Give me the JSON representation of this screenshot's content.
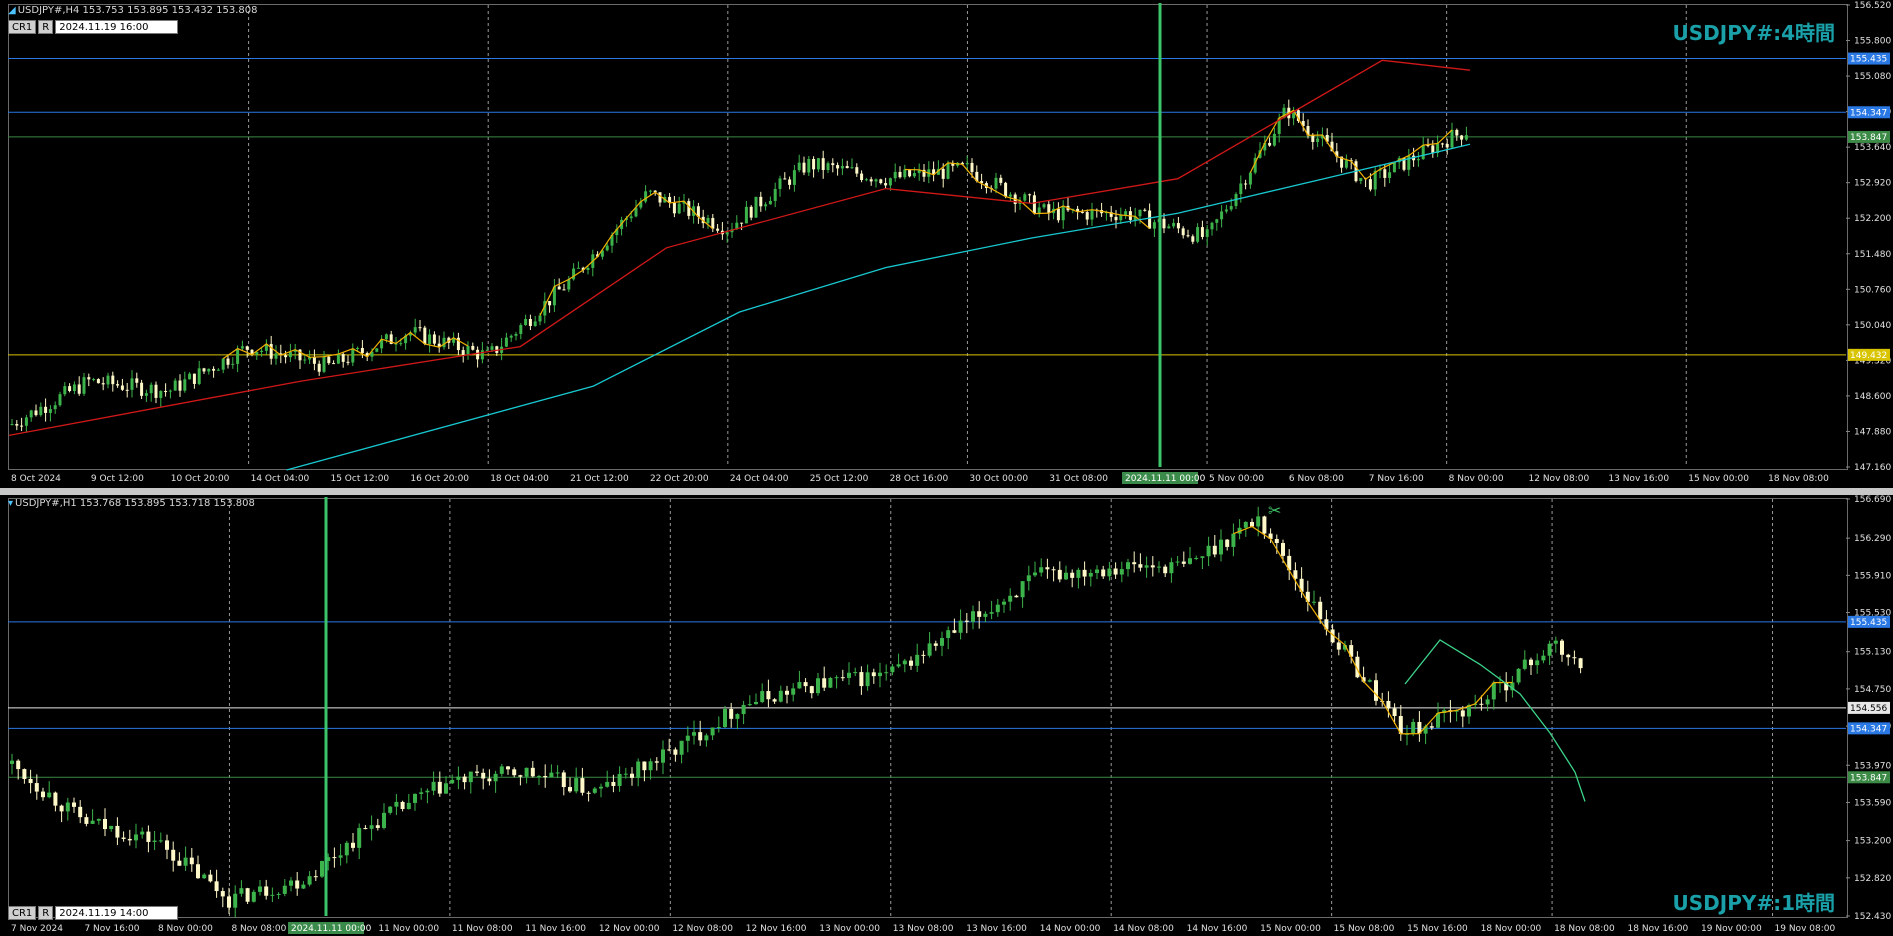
{
  "top": {
    "header": "USDJPY#,H4  153.753 153.895 153.432 153.808",
    "badge": {
      "a": "CR1",
      "b": "R",
      "datetime": "2024.11.19 16:00"
    },
    "title": "USDJPY#:4時間",
    "cursor_label": "2024.11.11 00:00",
    "lines": {
      "blue1": "155.435",
      "blue2": "154.347",
      "green": "153.847",
      "yellow": "149.432"
    }
  },
  "bottom": {
    "header": "USDJPY#,H1  153.768 153.895 153.718 153.808",
    "badge": {
      "a": "CR1",
      "b": "R",
      "datetime": "2024.11.19 14:00"
    },
    "title": "USDJPY#:1時間",
    "cursor_label": "2024.11.11 00:00",
    "lines": {
      "blue1": "155.435",
      "white": "154.556",
      "blue2": "154.347",
      "green": "153.847"
    }
  },
  "colors": {
    "bull": "#3cb44b",
    "bear": "#fff8c8",
    "grid": "#9a9a9a",
    "ma_red": "#d01818",
    "ma_cyan": "#18c8d0",
    "zigzag": "#f0b000",
    "hline_blue": "#2a78e4",
    "hline_yellow": "#d8c400",
    "hline_green": "#3b8a46",
    "cursor": "#3cc46a",
    "title": "#1aa0a8"
  },
  "chart_data": [
    {
      "type": "candlestick",
      "title": "USDJPY#:4時間",
      "symbol": "USDJPY#",
      "timeframe": "H4",
      "ylim": [
        147.16,
        156.52
      ],
      "y_ticks": [
        "156.520",
        "155.800",
        "155.080",
        "154.360",
        "153.640",
        "152.920",
        "152.200",
        "151.480",
        "150.760",
        "150.040",
        "149.320",
        "148.600",
        "147.880",
        "147.160"
      ],
      "x_ticks": [
        "8 Oct 2024",
        "9 Oct 12:00",
        "10 Oct 20:00",
        "14 Oct 04:00",
        "15 Oct 12:00",
        "16 Oct 20:00",
        "18 Oct 04:00",
        "21 Oct 12:00",
        "22 Oct 20:00",
        "24 Oct 04:00",
        "25 Oct 12:00",
        "28 Oct 16:00",
        "30 Oct 00:00",
        "31 Oct 08:00",
        "1 Nov 16:00",
        "5 Nov 00:00",
        "6 Nov 08:00",
        "7 Nov 16:00",
        "8 Nov 00:00",
        "12 Nov 08:00",
        "13 Nov 16:00",
        "15 Nov 00:00",
        "18 Nov 08:00"
      ],
      "path_points": [
        [
          "8 Oct 2024",
          148.0
        ],
        [
          "9 Oct 12:00",
          148.9
        ],
        [
          "10 Oct 20:00",
          148.7
        ],
        [
          "14 Oct 04:00",
          149.6
        ],
        [
          "15 Oct 12:00",
          149.2
        ],
        [
          "16 Oct 20:00",
          149.9
        ],
        [
          "18 Oct 04:00",
          149.4
        ],
        [
          "21 Oct 12:00",
          150.9
        ],
        [
          "22 Oct 20:00",
          152.7
        ],
        [
          "24 Oct 04:00",
          152.0
        ],
        [
          "25 Oct 12:00",
          153.3
        ],
        [
          "28 Oct 16:00",
          153.0
        ],
        [
          "30 Oct 00:00",
          153.2
        ],
        [
          "31 Oct 08:00",
          152.3
        ],
        [
          "1 Nov 16:00",
          152.3
        ],
        [
          "5 Nov 00:00",
          151.8
        ],
        [
          "6 Nov 08:00",
          154.4
        ],
        [
          "7 Nov 16:00",
          152.9
        ],
        [
          "8 Nov 00:00",
          153.8
        ],
        [
          "12 Nov 08:00",
          154.5
        ],
        [
          "13 Nov 16:00",
          155.8
        ],
        [
          "15 Nov 00:00",
          155.4
        ],
        [
          "18 Nov 08:00",
          154.6
        ],
        [
          "19 Nov 16:00",
          153.8
        ]
      ],
      "ma_red": [
        [
          0,
          147.8
        ],
        [
          0.2,
          148.9
        ],
        [
          0.35,
          149.6
        ],
        [
          0.45,
          151.6
        ],
        [
          0.6,
          152.8
        ],
        [
          0.7,
          152.5
        ],
        [
          0.8,
          153.0
        ],
        [
          0.87,
          154.2
        ],
        [
          0.94,
          155.4
        ],
        [
          1,
          155.2
        ]
      ],
      "ma_cyan": [
        [
          0.19,
          147.1
        ],
        [
          0.4,
          148.8
        ],
        [
          0.5,
          150.3
        ],
        [
          0.6,
          151.2
        ],
        [
          0.7,
          151.8
        ],
        [
          0.8,
          152.3
        ],
        [
          0.9,
          153.0
        ],
        [
          1,
          153.7
        ]
      ],
      "hlines": [
        {
          "label": "155.435",
          "value": 155.435,
          "color": "blue"
        },
        {
          "label": "154.347",
          "value": 154.347,
          "color": "blue"
        },
        {
          "label": "153.847",
          "value": 153.847,
          "color": "green"
        },
        {
          "label": "149.432",
          "value": 149.432,
          "color": "yellow"
        }
      ]
    },
    {
      "type": "candlestick",
      "title": "USDJPY#:1時間",
      "symbol": "USDJPY#",
      "timeframe": "H1",
      "ylim": [
        152.43,
        156.69
      ],
      "y_ticks": [
        "156.690",
        "156.290",
        "155.910",
        "155.530",
        "155.130",
        "154.750",
        "154.370",
        "153.970",
        "153.590",
        "153.200",
        "152.820",
        "152.430"
      ],
      "x_ticks": [
        "7 Nov 2024",
        "7 Nov 16:00",
        "8 Nov 00:00",
        "8 Nov 08:00",
        "8 Nov 16:00",
        "11 Nov 00:00",
        "11 Nov 08:00",
        "11 Nov 16:00",
        "12 Nov 00:00",
        "12 Nov 08:00",
        "12 Nov 16:00",
        "13 Nov 00:00",
        "13 Nov 08:00",
        "13 Nov 16:00",
        "14 Nov 00:00",
        "14 Nov 08:00",
        "14 Nov 16:00",
        "15 Nov 00:00",
        "15 Nov 08:00",
        "15 Nov 16:00",
        "18 Nov 00:00",
        "18 Nov 08:00",
        "18 Nov 16:00",
        "19 Nov 00:00",
        "19 Nov 08:00"
      ],
      "path_points": [
        [
          "7 Nov 2024",
          154.0
        ],
        [
          "7 Nov 16:00",
          153.4
        ],
        [
          "8 Nov 00:00",
          153.2
        ],
        [
          "8 Nov 08:00",
          152.6
        ],
        [
          "8 Nov 16:00",
          152.8
        ],
        [
          "11 Nov 00:00",
          153.4
        ],
        [
          "11 Nov 08:00",
          153.8
        ],
        [
          "11 Nov 16:00",
          153.9
        ],
        [
          "12 Nov 00:00",
          153.7
        ],
        [
          "12 Nov 08:00",
          154.1
        ],
        [
          "12 Nov 16:00",
          154.6
        ],
        [
          "13 Nov 00:00",
          154.8
        ],
        [
          "13 Nov 08:00",
          154.9
        ],
        [
          "13 Nov 16:00",
          155.4
        ],
        [
          "14 Nov 00:00",
          155.9
        ],
        [
          "14 Nov 08:00",
          156.0
        ],
        [
          "14 Nov 16:00",
          156.0
        ],
        [
          "15 Nov 00:00",
          156.5
        ],
        [
          "15 Nov 08:00",
          155.3
        ],
        [
          "15 Nov 16:00",
          154.3
        ],
        [
          "18 Nov 00:00",
          154.6
        ],
        [
          "18 Nov 08:00",
          155.2
        ],
        [
          "18 Nov 16:00",
          154.6
        ],
        [
          "19 Nov 00:00",
          154.2
        ],
        [
          "19 Nov 08:00",
          153.7
        ]
      ],
      "hlines": [
        {
          "label": "155.435",
          "value": 155.435,
          "color": "blue"
        },
        {
          "label": "154.556",
          "value": 154.556,
          "color": "white"
        },
        {
          "label": "154.347",
          "value": 154.347,
          "color": "blue"
        },
        {
          "label": "153.847",
          "value": 153.847,
          "color": "green"
        }
      ]
    }
  ]
}
